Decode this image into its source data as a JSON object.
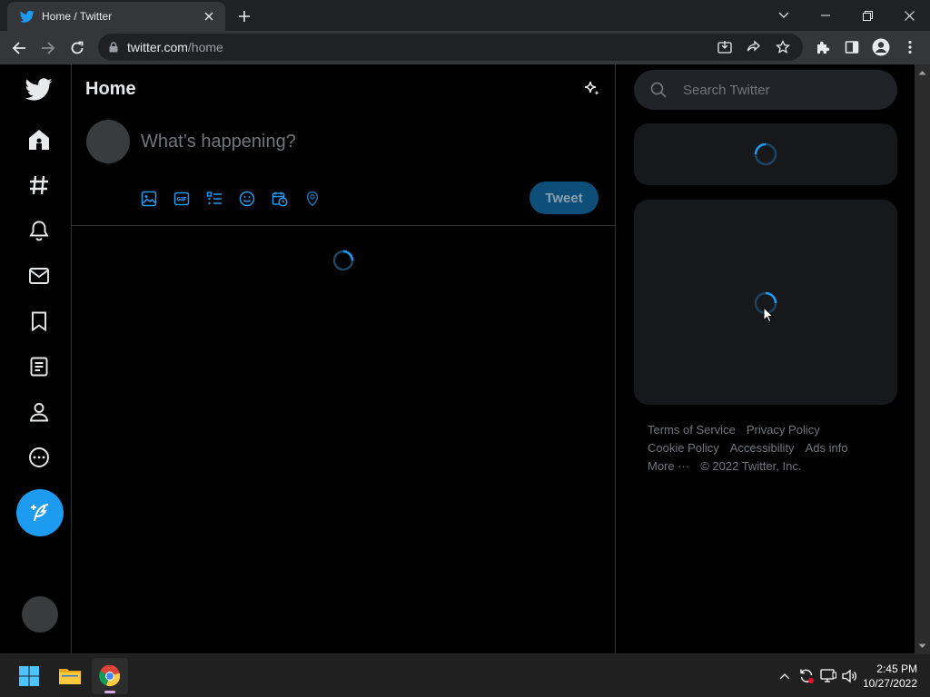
{
  "browser": {
    "tab_title": "Home / Twitter",
    "url_host": "twitter.com",
    "url_path": "/home"
  },
  "left_nav": {
    "items": [
      "twitter-logo",
      "home",
      "explore",
      "notifications",
      "messages",
      "bookmarks",
      "lists",
      "profile",
      "more",
      "compose"
    ]
  },
  "main": {
    "title": "Home",
    "composer_placeholder": "What’s happening?",
    "tweet_button": "Tweet"
  },
  "sidebar": {
    "search_placeholder": "Search Twitter",
    "footer_links": [
      "Terms of Service",
      "Privacy Policy",
      "Cookie Policy",
      "Accessibility",
      "Ads info",
      "More ···"
    ],
    "copyright": "© 2022 Twitter, Inc."
  },
  "taskbar": {
    "time": "2:45 PM",
    "date": "10/27/2022"
  },
  "colors": {
    "accent": "#1d9bf0",
    "background": "#000000",
    "border": "#2f3336",
    "muted_text": "#71767b"
  }
}
